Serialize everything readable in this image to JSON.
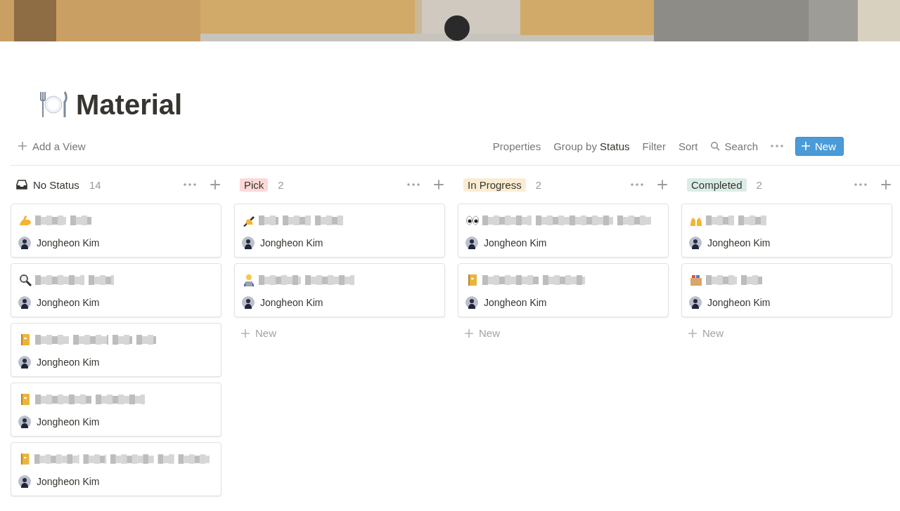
{
  "page": {
    "title": "Material"
  },
  "toolbar": {
    "add_view": "Add a View",
    "properties": "Properties",
    "group_by": "Group by **Status**",
    "filter": "Filter",
    "sort": "Sort",
    "search": "Search",
    "new_button": "New"
  },
  "columns": [
    {
      "kind": "plain",
      "label": "No Status",
      "count": "14",
      "cards": [
        {
          "kind": "muscle",
          "person": "Jongheon Kim"
        },
        {
          "kind": "magnifier",
          "person": "Jongheon Kim"
        },
        {
          "kind": "notebook",
          "person": "Jongheon Kim"
        },
        {
          "kind": "notebook",
          "person": "Jongheon Kim"
        },
        {
          "kind": "notebook",
          "person": "Jongheon Kim"
        }
      ]
    },
    {
      "kind": "tag",
      "label": "Pick",
      "color": "#fbd9d7",
      "count": "2",
      "new_label": "New",
      "cards": [
        {
          "kind": "writing",
          "person": "Jongheon Kim"
        },
        {
          "kind": "technologist",
          "person": "Jongheon Kim"
        }
      ]
    },
    {
      "kind": "tag",
      "label": "In Progress",
      "color": "#faecd3",
      "count": "2",
      "new_label": "New",
      "cards": [
        {
          "kind": "eyes",
          "person": "Jongheon Kim"
        },
        {
          "kind": "notebook",
          "person": "Jongheon Kim"
        }
      ]
    },
    {
      "kind": "tag",
      "label": "Completed",
      "color": "#dbece6",
      "count": "2",
      "new_label": "New",
      "cards": [
        {
          "kind": "hands",
          "person": "Jongheon Kim"
        },
        {
          "kind": "box",
          "person": "Jongheon Kim"
        }
      ]
    }
  ]
}
